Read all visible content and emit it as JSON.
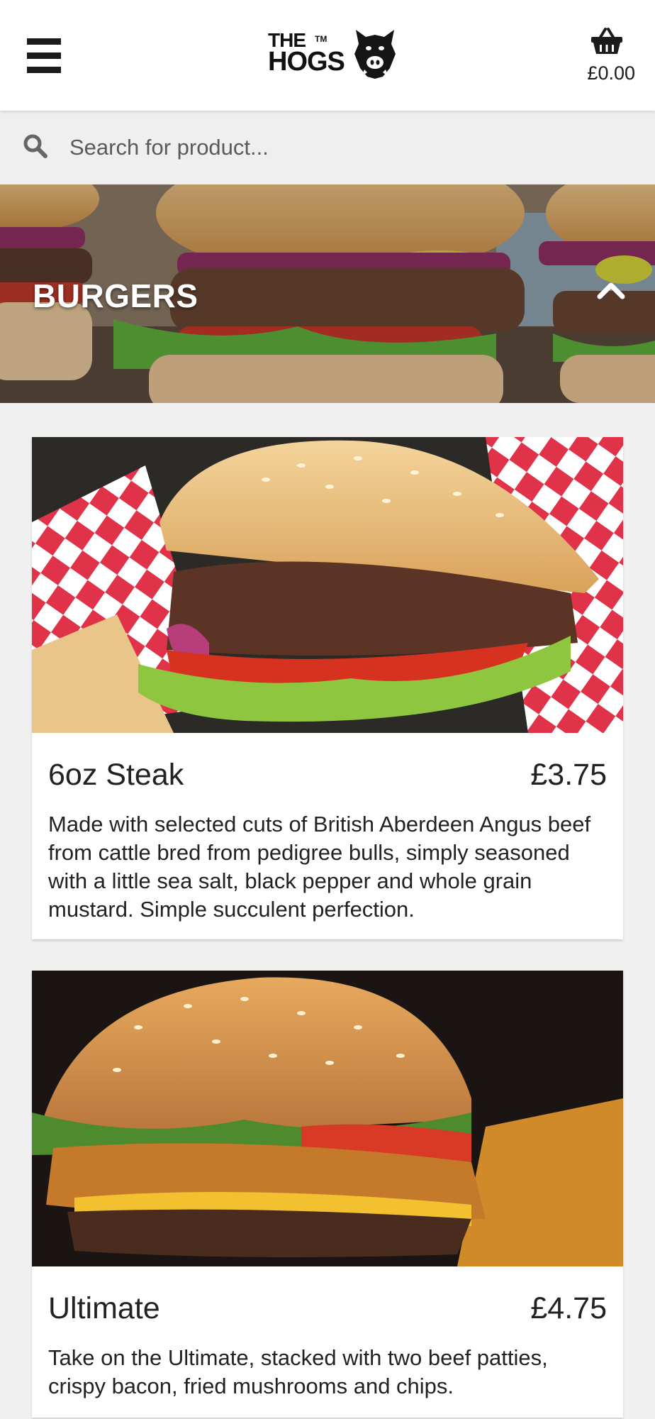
{
  "header": {
    "logo": {
      "the": "THE",
      "tm": "TM",
      "hogs": "HOGS"
    },
    "basket_total": "£0.00"
  },
  "search": {
    "placeholder": "Search for product..."
  },
  "category": {
    "title": "BURGERS"
  },
  "products": [
    {
      "name": "6oz Steak",
      "price": "£3.75",
      "description": "Made with selected cuts of British Aberdeen Angus beef from cattle bred from pedigree bulls, simply seasoned with a little sea salt, black pepper and whole grain mustard. Simple succulent perfection."
    },
    {
      "name": "Ultimate",
      "price": "£4.75",
      "description": "Take on the Ultimate, stacked with two beef patties, crispy bacon, fried mushrooms and chips."
    }
  ],
  "colors": {
    "header_bg": "#ffffff",
    "page_bg": "#f0f0f0",
    "search_bg": "#efefef",
    "text": "#222222",
    "banner_text": "#ffffff"
  },
  "icons": {
    "menu": "hamburger-menu-icon",
    "basket": "shopping-basket-icon",
    "search": "search-icon",
    "collapse": "chevron-up-icon"
  }
}
